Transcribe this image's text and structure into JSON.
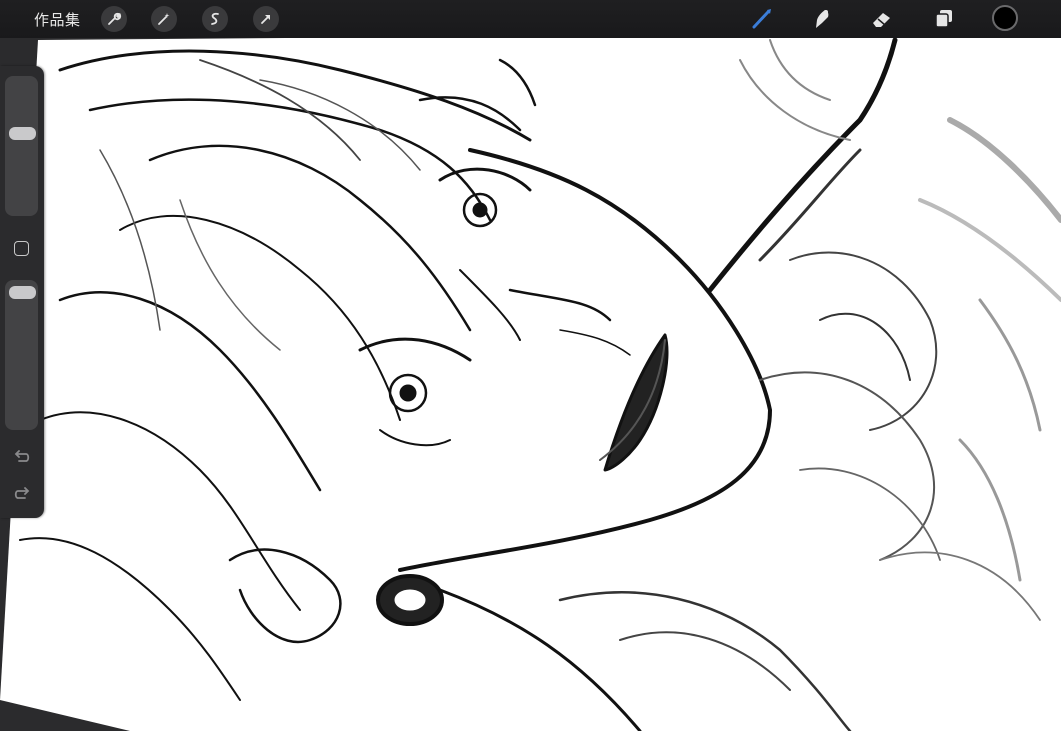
{
  "toolbar": {
    "gallery_label": "作品集",
    "left_tools": [
      "wrench-icon",
      "magic-wand-icon",
      "selection-icon",
      "transform-arrow-icon"
    ],
    "right_tools": [
      "brush-icon",
      "smudge-icon",
      "eraser-icon",
      "layers-icon"
    ],
    "active_tool": "brush",
    "accent_color": "#3b7dd8",
    "current_color": "#000000"
  },
  "sidebar": {
    "brush_size_level": 0.6,
    "opacity_level": 1.0,
    "controls": [
      "brush-size-slider",
      "modify-button",
      "opacity-slider",
      "undo-button",
      "redo-button"
    ]
  },
  "canvas": {
    "content": "pencil-sketch-illustration",
    "background": "#ffffff"
  }
}
